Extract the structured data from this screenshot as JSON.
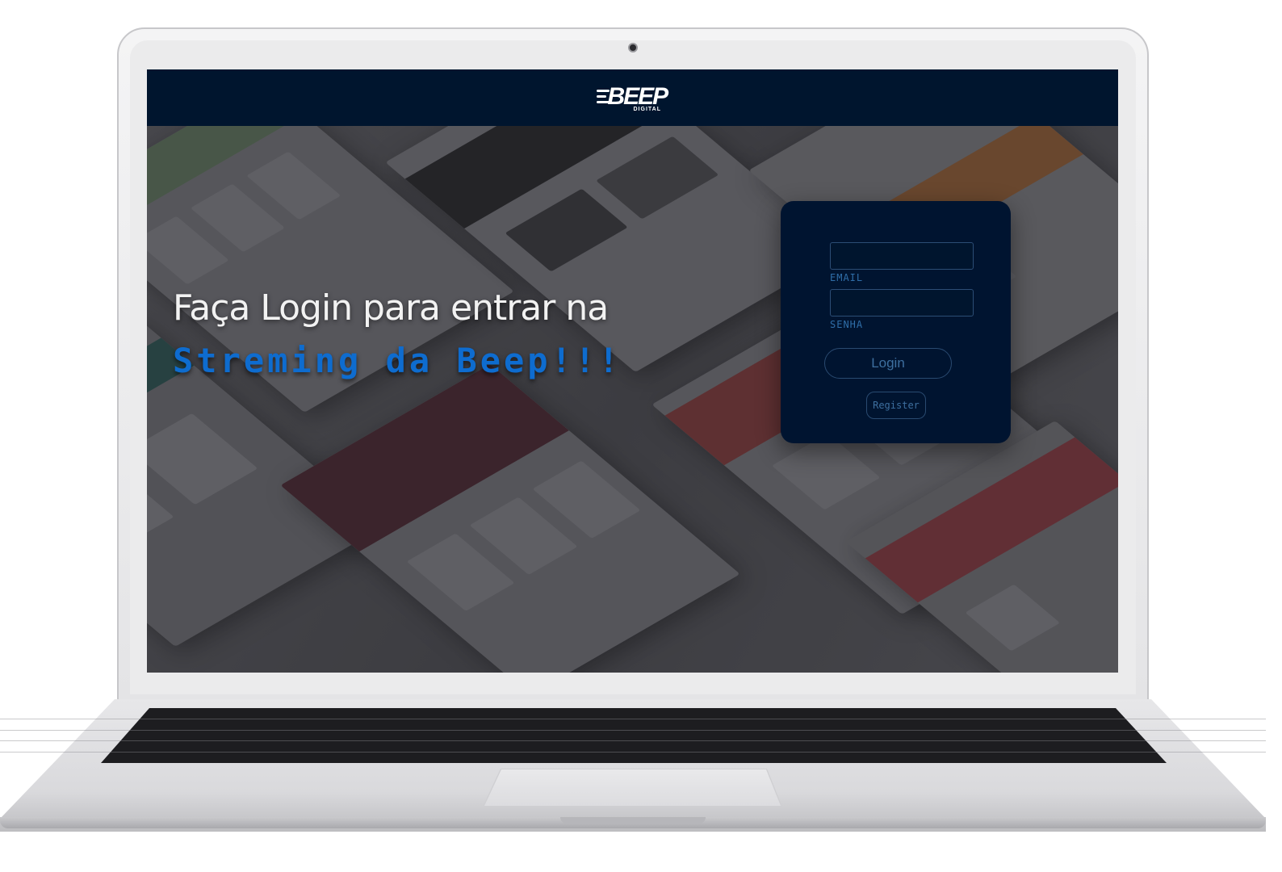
{
  "brand": {
    "logo_text": "BEEP",
    "logo_subtext": "DIGITAL"
  },
  "hero": {
    "line1": "Faça Login para entrar na",
    "line2": "Streming da Beep!!!"
  },
  "login": {
    "email_value": "",
    "email_label": "EMAIL",
    "password_value": "",
    "password_label": "SENHA",
    "login_button": "Login",
    "register_button": "Register"
  },
  "colors": {
    "topbar": "#00152e",
    "card": "#001430",
    "accent_blue": "#0e6ccf",
    "label_blue": "#2f6ea8"
  }
}
